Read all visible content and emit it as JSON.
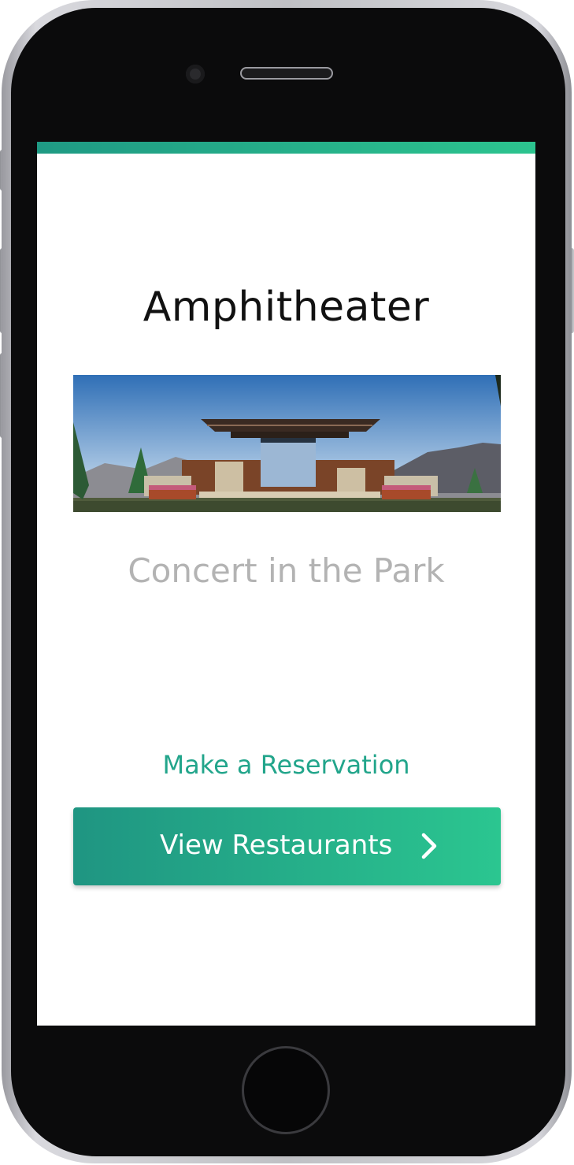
{
  "venue": {
    "title": "Amphitheater",
    "image_icon": "amphitheater-photo"
  },
  "event": {
    "name": "Concert in the Park"
  },
  "actions": {
    "reservation_label": "Make a Reservation",
    "restaurants_label": "View Restaurants",
    "restaurants_icon": "chevron-right-icon"
  },
  "colors": {
    "accent_start": "#1f9582",
    "accent_end": "#2bc690",
    "link": "#22a58b",
    "event_text": "#b3b3b3"
  }
}
